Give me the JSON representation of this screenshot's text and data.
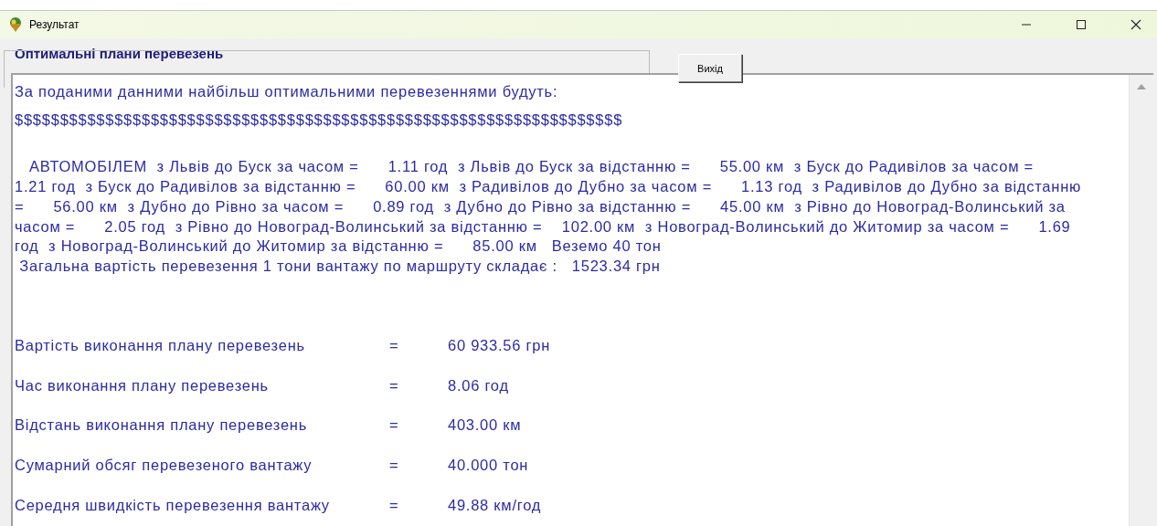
{
  "window": {
    "title": "Результат"
  },
  "group": {
    "title": "Оптимальні плани перевезень"
  },
  "exit_button": {
    "label": "Вихід"
  },
  "memo": {
    "lines": [
      {
        "kind": "heading",
        "text": "За поданими данними найбільш оптимальними перевезеннями будуть:"
      },
      {
        "kind": "separator",
        "text": "$$$$$$$$$$$$$$$$$$$$$$$$$$$$$$$$$$$$$$$$$$$$$$$$$$$$$$$$$$$$$$$$$$$"
      },
      {
        "kind": "route",
        "text": "   АВТОМОБІЛЕМ  з Львів до Буск за часом =      1.11 год  з Львів до Буск за відстанню =      55.00 км  з Буск до Радивілов за часом ="
      },
      {
        "kind": "route",
        "text": "1.21 год  з Буск до Радивілов за відстанню =      60.00 км  з Радивілов до Дубно за часом =      1.13 год  з Радивілов до Дубно за відстанню"
      },
      {
        "kind": "route",
        "text": "=      56.00 км  з Дубно до Рівно за часом =      0.89 год  з Дубно до Рівно за відстанню =      45.00 км  з Рівно до Новоград-Волинський за"
      },
      {
        "kind": "route",
        "text": "часом =      2.05 год  з Рівно до Новоград-Волинський за відстанню =    102.00 км  з Новоград-Волинський до Житомир за часом =      1.69"
      },
      {
        "kind": "route",
        "text": "год  з Новоград-Волинський до Житомир за відстанню =      85.00 км   Веземо 40 тон"
      },
      {
        "kind": "total",
        "text": " Загальна вартість перевезення 1 тони вантажу по маршруту складає :   1523.34 грн"
      }
    ],
    "stats": [
      {
        "label": "Вартість виконання плану перевезень",
        "sign": "=",
        "value": "60 933.56 грн"
      },
      {
        "label": "Час виконання плану перевезень",
        "sign": "=",
        "value": "8.06 год"
      },
      {
        "label": "Відстань виконання плану перевезень",
        "sign": "=",
        "value": "403.00 км"
      },
      {
        "label": "Сумарний обсяг перевезеного вантажу",
        "sign": "=",
        "value": "40.000 тон"
      },
      {
        "label": "Середня швидкість перевезення вантажу",
        "sign": "=",
        "value": "49.88 км/год"
      }
    ]
  }
}
